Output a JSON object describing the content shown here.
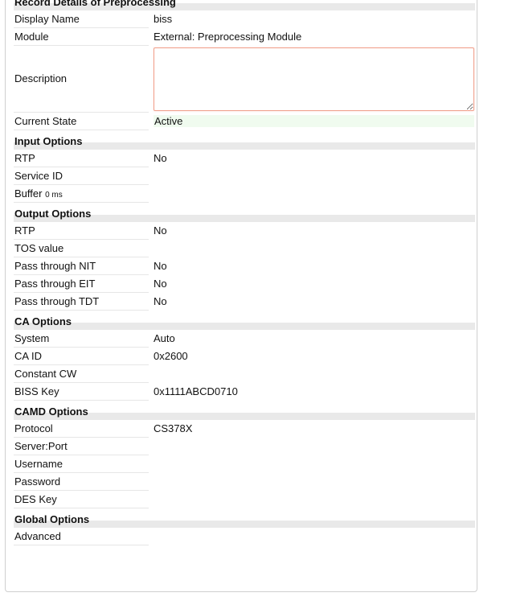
{
  "record": {
    "title": "Record Details of Preprocessing",
    "display_name_label": "Display Name",
    "display_name": "biss",
    "module_label": "Module",
    "module": "External: Preprocessing Module",
    "description_label": "Description",
    "description_value": "",
    "current_state_label": "Current State",
    "current_state": "Active"
  },
  "input_options": {
    "title": "Input Options",
    "rtp_label": "RTP",
    "rtp": "No",
    "service_id_label": "Service ID",
    "service_id": "",
    "buffer_label": "Buffer",
    "buffer_value": "0 ms"
  },
  "output_options": {
    "title": "Output Options",
    "rtp_label": "RTP",
    "rtp": "No",
    "tos_label": "TOS value",
    "tos": "",
    "nit_label": "Pass through NIT",
    "nit": "No",
    "eit_label": "Pass through EIT",
    "eit": "No",
    "tdt_label": "Pass through TDT",
    "tdt": "No"
  },
  "ca_options": {
    "title": "CA Options",
    "system_label": "System",
    "system": "Auto",
    "ca_id_label": "CA ID",
    "ca_id": "0x2600",
    "constant_cw_label": "Constant CW",
    "constant_cw": "",
    "biss_key_label": "BISS Key",
    "biss_key": "0x1111ABCD0710"
  },
  "camd_options": {
    "title": "CAMD Options",
    "protocol_label": "Protocol",
    "protocol": "CS378X",
    "server_port_label": "Server:Port",
    "server_port": "",
    "username_label": "Username",
    "username": "",
    "password_label": "Password",
    "password": "",
    "des_key_label": "DES Key",
    "des_key": ""
  },
  "global_options": {
    "title": "Global Options",
    "advanced_label": "Advanced"
  },
  "colors": {
    "state_bg": "#f0fbef",
    "textarea_border": "#f0a08c",
    "section_bar": "#e9e9e9"
  }
}
